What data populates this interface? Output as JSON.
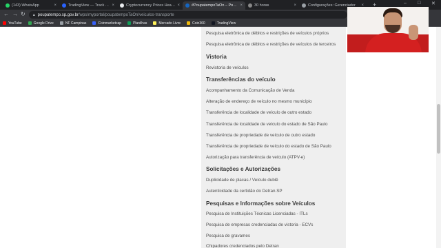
{
  "browser": {
    "tabs": [
      {
        "label": "(143) WhatsApp",
        "color": "#25d366",
        "active": false
      },
      {
        "label": "TradingView — Track All Mark",
        "color": "#2962ff",
        "active": false
      },
      {
        "label": "Cryptocurrency Prices Heatm",
        "color": "#e8eaed",
        "active": false
      },
      {
        "label": "#PoupatempoTaOn – Portal",
        "color": "#1565c0",
        "active": true
      },
      {
        "label": "30 horas",
        "color": "#888888",
        "active": false
      },
      {
        "label": "Configurações: Gerenciador",
        "color": "#9aa0a6",
        "active": false
      }
    ],
    "new_tab": "+",
    "window_controls": {
      "minimize": "–",
      "maximize": "□",
      "close": "✕"
    },
    "url_domain": "poupatempo.sp.gov.br",
    "url_path": "/wps/myportal/poupatempoTaOn/veiculos-transporte",
    "bookmarks": [
      {
        "label": "YouTube",
        "color": "#ff0000"
      },
      {
        "label": "Google Drive",
        "color": "#34a853"
      },
      {
        "label": "NF Campinas",
        "color": "#9aa0a6"
      },
      {
        "label": "Coinmarketcap",
        "color": "#3861fb"
      },
      {
        "label": "Planilhas",
        "color": "#0f9d58"
      },
      {
        "label": "Mercado Livre",
        "color": "#fff159"
      },
      {
        "label": "Coin360",
        "color": "#f0b90b"
      },
      {
        "label": "TradingView",
        "color": "#131722"
      }
    ]
  },
  "content": {
    "lines": [
      {
        "type": "link",
        "text": "Pesquisa eletrônica de débitos e restrições de veículos próprios"
      },
      {
        "type": "link",
        "text": "Pesquisa eletrônica de débitos e restrições de veículos de terceiros"
      },
      {
        "type": "heading",
        "text": "Vistoria"
      },
      {
        "type": "link",
        "text": "Revistoria de veículos"
      },
      {
        "type": "heading",
        "text": "Transferências do veículo"
      },
      {
        "type": "link",
        "text": "Acompanhamento da Comunicação de Venda"
      },
      {
        "type": "link",
        "text": "Alteração de endereço de veículo no mesmo município"
      },
      {
        "type": "link",
        "text": "Transferência de localidade de veículo de outro estado"
      },
      {
        "type": "link",
        "text": "Transferência de localidade de veículo do estado de São Paulo"
      },
      {
        "type": "link",
        "text": "Transferência de propriedade de veículo de outro estado"
      },
      {
        "type": "link",
        "text": "Transferência de propriedade de veículo do estado de São Paulo"
      },
      {
        "type": "link",
        "text": "Autorização para transferência de veículo (ATPV-e)"
      },
      {
        "type": "heading",
        "text": "Solicitações e Autorizações"
      },
      {
        "type": "link",
        "text": "Duplicidade de placas / Veículo dublê"
      },
      {
        "type": "link",
        "text": "Autenticidade da certidão do Detran.SP"
      },
      {
        "type": "heading",
        "text": "Pesquisas e Informações sobre Veículos"
      },
      {
        "type": "link",
        "text": "Pesquisa de Instituições Técnicas Licenciadas - ITLs"
      },
      {
        "type": "link",
        "text": "Pesquisa de empresas credenciadas de vistoria - ECVs"
      },
      {
        "type": "link",
        "text": "Pesquisa de gravames"
      },
      {
        "type": "link",
        "text": "Chipadores credenciados pelo Detran"
      }
    ]
  },
  "scroll": {
    "position": 0.45
  }
}
